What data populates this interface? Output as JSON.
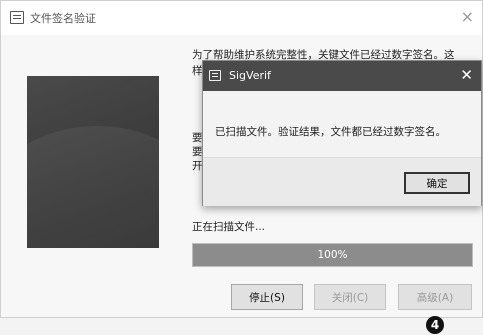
{
  "main_window": {
    "title": "文件签名验证",
    "close_glyph": "×",
    "intro_lines": [
      "为了帮助维护系统完整性，关键文件已经过数字签名。这",
      "样"
    ],
    "side_text_lines": [
      "要",
      "要",
      "开"
    ],
    "status_label": "正在扫描文件...",
    "progress": {
      "percent": 100,
      "text": "100%"
    },
    "buttons": {
      "stop": "停止(S)",
      "close": "关闭(C)",
      "advanced": "高级(A)"
    }
  },
  "dialog": {
    "title": "SigVerif",
    "close_glyph": "✕",
    "message": "已扫描文件。验证结果，文件都已经过数字签名。",
    "ok_label": "确定"
  },
  "step_badge": "4",
  "icons": {
    "window_icon": "document-check-icon",
    "dialog_icon": "document-check-icon"
  },
  "colors": {
    "dialog_title_bg": "#4a4a4a",
    "progress_fill": "#8c8c8c"
  }
}
